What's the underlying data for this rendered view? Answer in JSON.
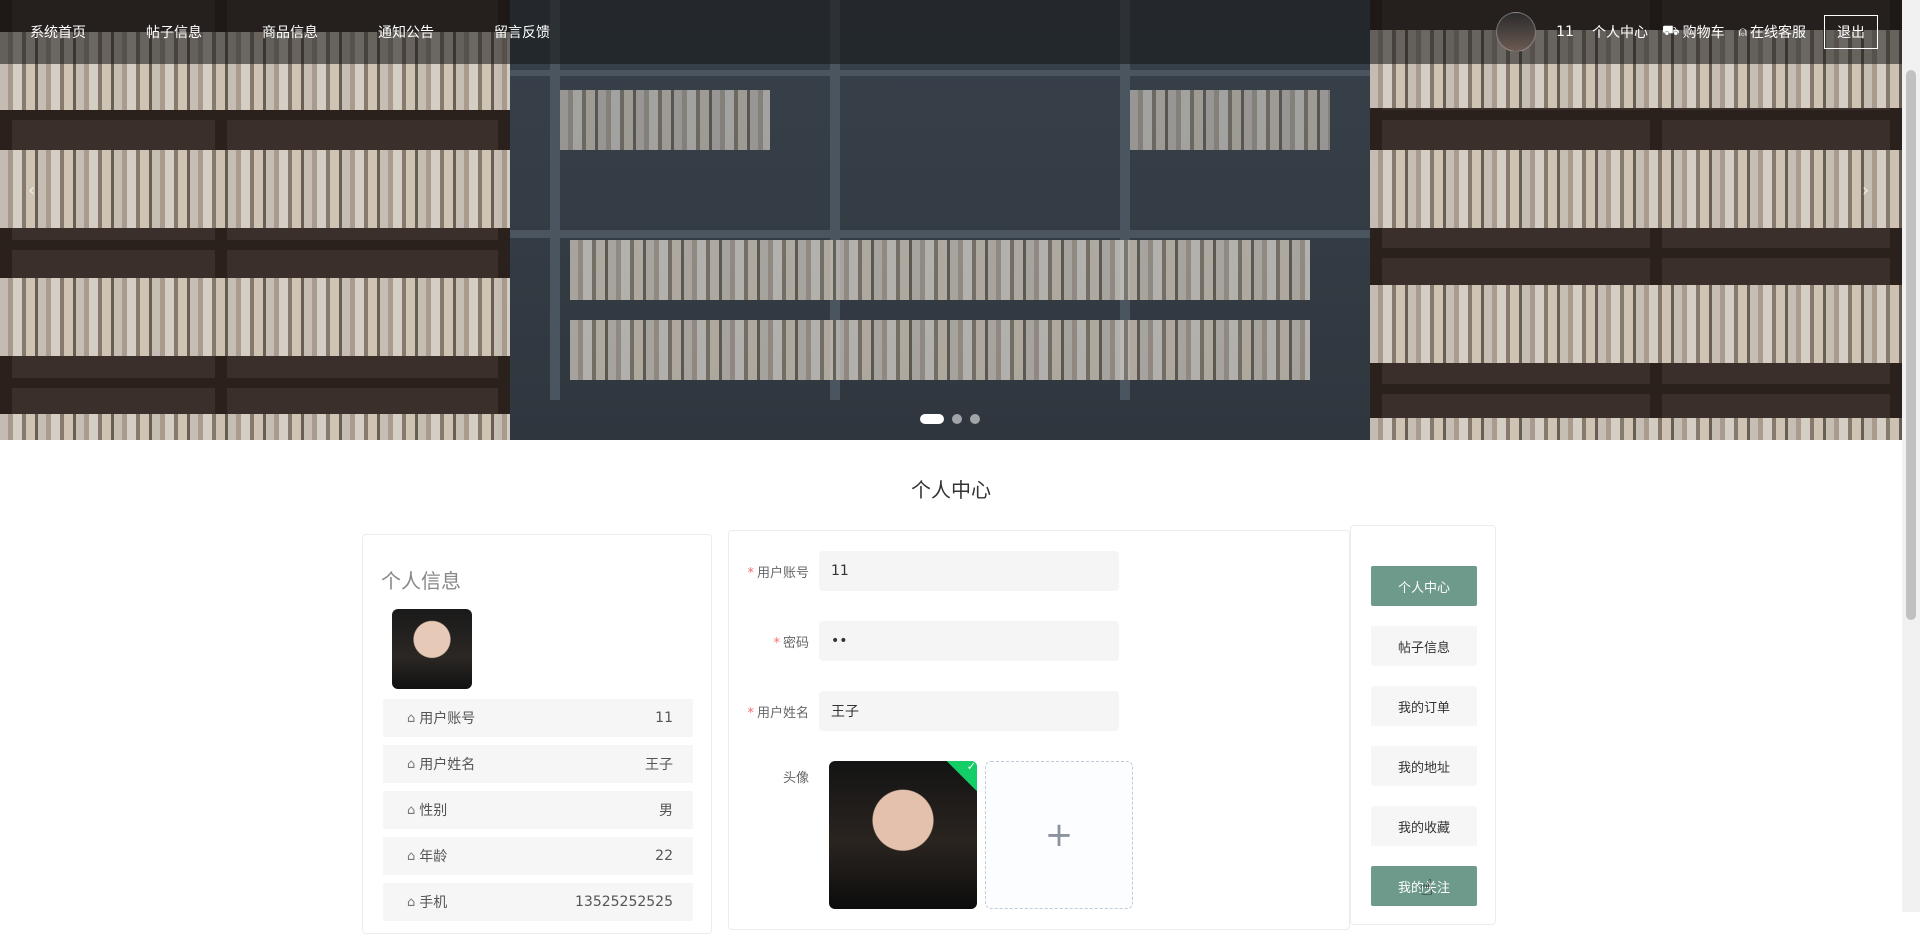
{
  "nav": {
    "items": [
      "系统首页",
      "帖子信息",
      "商品信息",
      "通知公告",
      "留言反馈"
    ],
    "user_id": "11",
    "personal_center": "个人中心",
    "cart": "购物车",
    "service": "在线客服",
    "logout": "退出"
  },
  "page_title": "个人中心",
  "profile_card": {
    "title": "个人信息",
    "rows": [
      {
        "label": "用户账号",
        "value": "11"
      },
      {
        "label": "用户姓名",
        "value": "王子"
      },
      {
        "label": "性别",
        "value": "男"
      },
      {
        "label": "年龄",
        "value": "22"
      },
      {
        "label": "手机",
        "value": "13525252525"
      }
    ]
  },
  "form": {
    "account": {
      "label": "用户账号",
      "value": "11"
    },
    "password": {
      "label": "密码",
      "value": "••"
    },
    "name": {
      "label": "用户姓名",
      "value": "王子"
    },
    "avatar": {
      "label": "头像",
      "add_symbol": "+"
    }
  },
  "right_menu": {
    "items": [
      "个人中心",
      "帖子信息",
      "我的订单",
      "我的地址",
      "我的收藏",
      "我的关注"
    ],
    "active_index": 0,
    "hovered_index": 5
  },
  "colors": {
    "accent": "#6d9a8a",
    "required_star": "#f56c6c",
    "upload_success": "#13ce66"
  }
}
